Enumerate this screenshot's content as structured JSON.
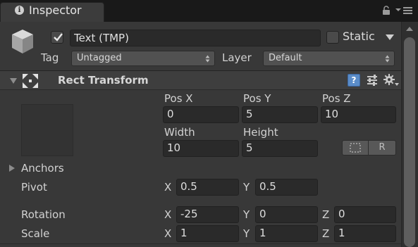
{
  "tab": {
    "title": "Inspector",
    "icon": "info-icon"
  },
  "header": {
    "active": true,
    "name": "Text (TMP)",
    "static_label": "Static",
    "static": false,
    "tag_label": "Tag",
    "tag_value": "Untagged",
    "layer_label": "Layer",
    "layer_value": "Default"
  },
  "component": {
    "title": "Rect Transform",
    "expanded": true,
    "help_glyph": "?",
    "pos_x_label": "Pos X",
    "pos_y_label": "Pos Y",
    "pos_z_label": "Pos Z",
    "pos_x": "0",
    "pos_y": "5",
    "pos_z": "10",
    "width_label": "Width",
    "height_label": "Height",
    "width": "10",
    "height": "5",
    "r_button": "R",
    "anchors_label": "Anchors",
    "pivot_label": "Pivot",
    "pivot_x": "0.5",
    "pivot_y": "0.5",
    "rotation_label": "Rotation",
    "rotation_x": "-25",
    "rotation_y": "0",
    "rotation_z": "0",
    "scale_label": "Scale",
    "scale_x": "1",
    "scale_y": "1",
    "scale_z": "1",
    "axis_x": "X",
    "axis_y": "Y",
    "axis_z": "Z"
  },
  "colors": {
    "panel_bg": "#383838",
    "tab_strip": "#191919",
    "field_bg": "#2a2a2a",
    "help_blue": "#5a8cc8"
  }
}
